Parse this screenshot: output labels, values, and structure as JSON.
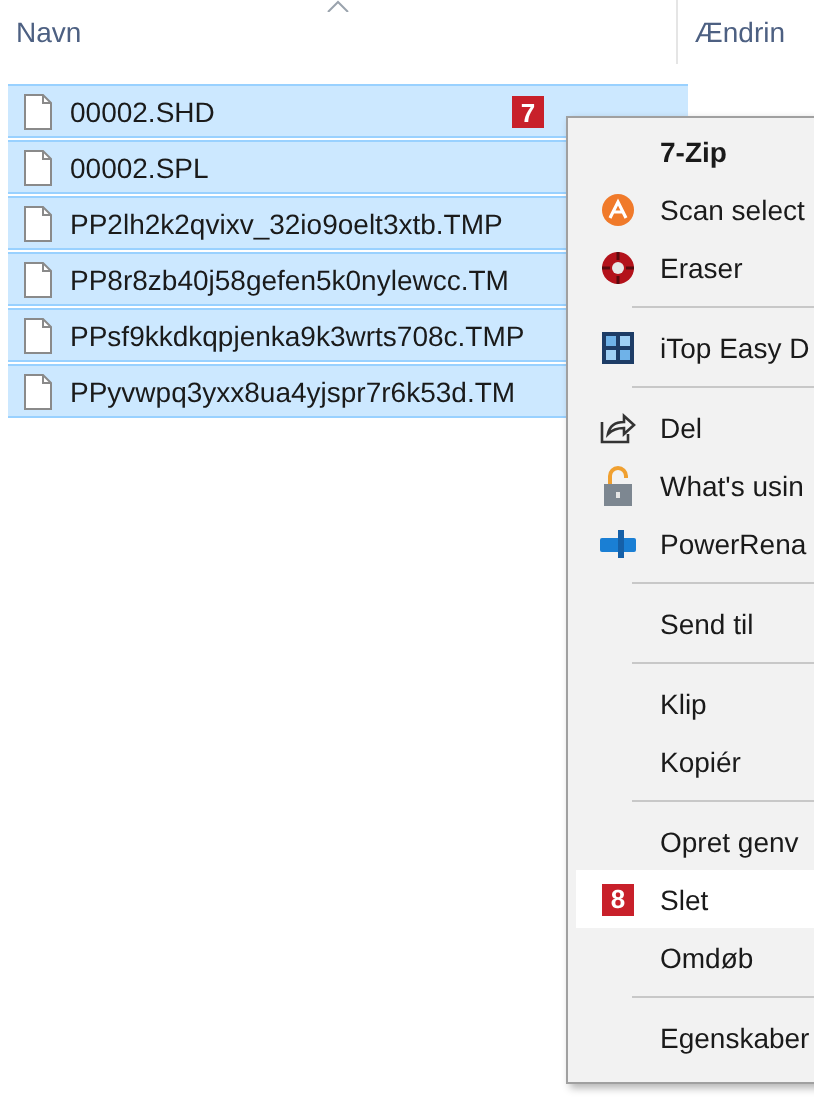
{
  "columns": [
    {
      "label": "Navn",
      "sorted": true
    },
    {
      "label": "Ændrin",
      "sorted": false
    }
  ],
  "files": [
    {
      "name": "00002.SHD",
      "selected": true,
      "badge": "7"
    },
    {
      "name": "00002.SPL",
      "selected": true
    },
    {
      "name": "PP2lh2k2qvixv_32io9oelt3xtb.TMP",
      "selected": true
    },
    {
      "name": "PP8r8zb40j58gefen5k0nylewcc.TM",
      "selected": true
    },
    {
      "name": "PPsf9kkdkqpjenka9k3wrts708c.TMP",
      "selected": true
    },
    {
      "name": "PPyvwpq3yxx8ua4yjspr7r6k53d.TM",
      "selected": true
    }
  ],
  "context_menu": {
    "items": [
      {
        "kind": "header",
        "label": "7-Zip"
      },
      {
        "kind": "item",
        "label": "Scan select",
        "selected": false
      },
      {
        "kind": "item",
        "label": "Eraser",
        "selected": false
      },
      {
        "kind": "separator"
      },
      {
        "kind": "item",
        "label": "iTop Easy D",
        "selected": false
      },
      {
        "kind": "separator"
      },
      {
        "kind": "item",
        "label": "Del",
        "selected": false
      },
      {
        "kind": "item",
        "label": "What's usin",
        "selected": false
      },
      {
        "kind": "item",
        "label": "PowerRena",
        "selected": false
      },
      {
        "kind": "separator"
      },
      {
        "kind": "item",
        "label": "Send til",
        "selected": false
      },
      {
        "kind": "separator"
      },
      {
        "kind": "item",
        "label": "Klip",
        "selected": false
      },
      {
        "kind": "item",
        "label": "Kopiér",
        "selected": false
      },
      {
        "kind": "separator"
      },
      {
        "kind": "item",
        "label": "Opret genv",
        "selected": false
      },
      {
        "kind": "item",
        "label": "Slet",
        "selected": true,
        "badge": "8"
      },
      {
        "kind": "item",
        "label": "Omdøb",
        "selected": false
      },
      {
        "kind": "separator"
      },
      {
        "kind": "item",
        "label": "Egenskaber",
        "selected": false
      }
    ]
  }
}
